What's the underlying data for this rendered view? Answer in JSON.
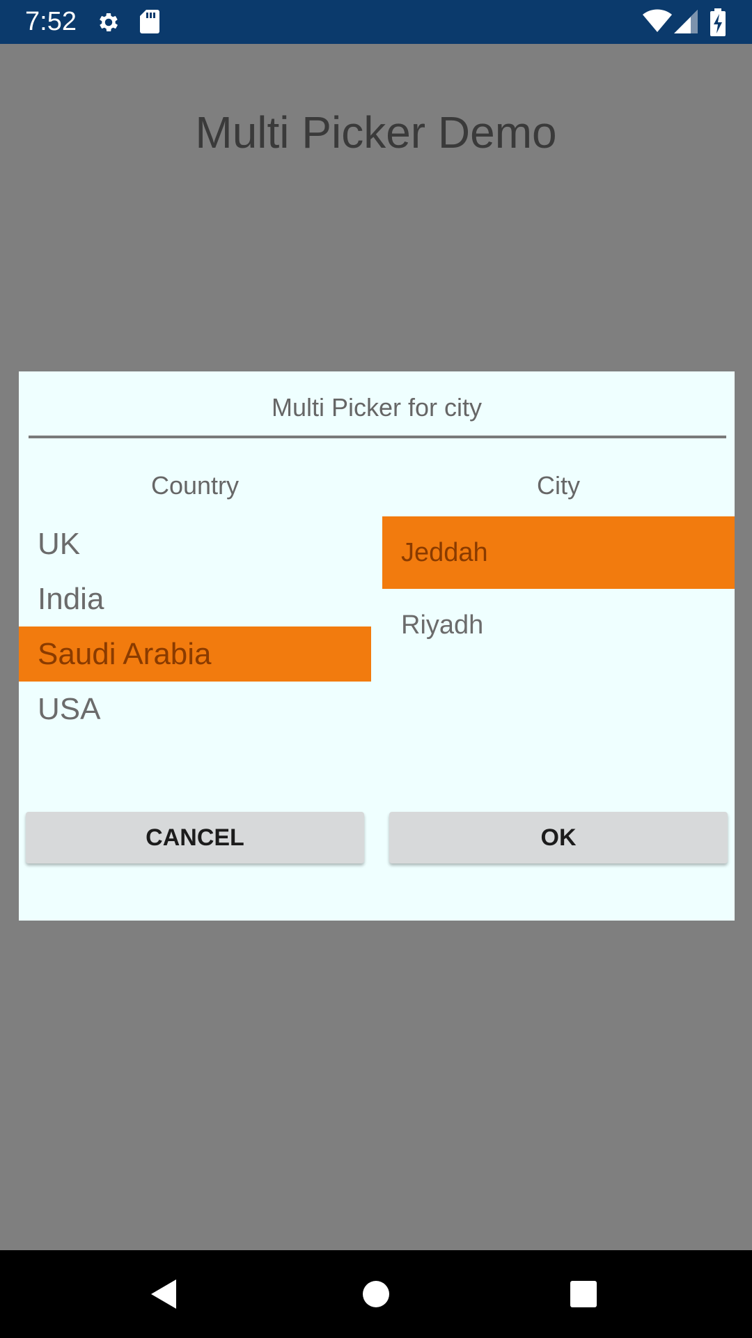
{
  "status_bar": {
    "time": "7:52",
    "icons": [
      "gear-icon",
      "sd-card-icon",
      "wifi-icon",
      "cell-signal-icon",
      "battery-charging-icon"
    ]
  },
  "app": {
    "title": "Multi Picker Demo"
  },
  "dialog": {
    "title": "Multi Picker for city",
    "country_header": "Country",
    "city_header": "City",
    "countries": [
      "UK",
      "India",
      "Saudi Arabia",
      "USA"
    ],
    "selected_country": "Saudi Arabia",
    "cities": [
      "Jeddah",
      "Riyadh"
    ],
    "selected_city": "Jeddah",
    "cancel_label": "CANCEL",
    "ok_label": "OK"
  },
  "colors": {
    "status_bar": "#0b3a6c",
    "scrim": "#7f7f7f",
    "dialog_bg": "#efffff",
    "selection": "#f27b0e",
    "button_bg": "#d7d9da"
  },
  "nav_bar": {
    "icons": [
      "back-icon",
      "home-icon",
      "recents-icon"
    ]
  }
}
